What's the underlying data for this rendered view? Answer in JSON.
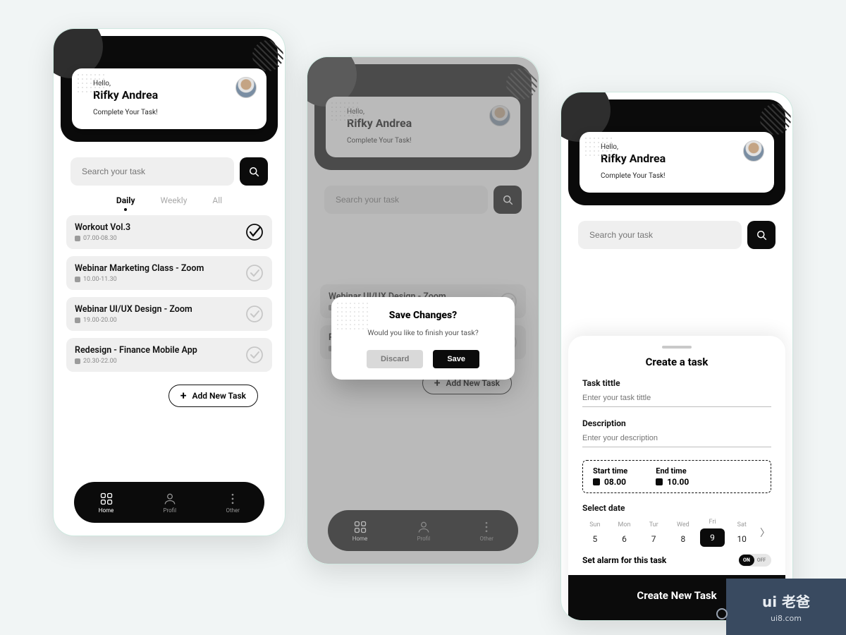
{
  "greeting": {
    "hello": "Hello,",
    "name": "Rifky Andrea",
    "subtitle": "Complete Your Task!"
  },
  "search": {
    "placeholder": "Search your task"
  },
  "tabs": {
    "daily": "Daily",
    "weekly": "Weekly",
    "all": "All"
  },
  "tasks": [
    {
      "title": "Workout Vol.3",
      "time": "07.00-08.30",
      "done": true
    },
    {
      "title": "Webinar Marketing Class - Zoom",
      "time": "10.00-11.30",
      "done": false
    },
    {
      "title": "Webinar UI/UX Design - Zoom",
      "time": "19.00-20.00",
      "done": false
    },
    {
      "title": "Redesign - Finance Mobile App",
      "time": "20.30-22.00",
      "done": false
    }
  ],
  "addTask": "Add New Task",
  "nav": {
    "home": "Home",
    "profil": "Profil",
    "other": "Other"
  },
  "modal": {
    "title": "Save Changes?",
    "message": "Would you like to finish your task?",
    "discard": "Discard",
    "save": "Save"
  },
  "create": {
    "heading": "Create a task",
    "taskTitleLabel": "Task tittle",
    "taskTitlePlaceholder": "Enter your task tittle",
    "descLabel": "Description",
    "descPlaceholder": "Enter your description",
    "startLabel": "Start time",
    "startValue": "08.00",
    "endLabel": "End time",
    "endValue": "10.00",
    "selectDate": "Select date",
    "days": [
      {
        "name": "Sun",
        "num": "5"
      },
      {
        "name": "Mon",
        "num": "6"
      },
      {
        "name": "Tur",
        "num": "7"
      },
      {
        "name": "Wed",
        "num": "8"
      },
      {
        "name": "Fri",
        "num": "9"
      },
      {
        "name": "Sat",
        "num": "10"
      }
    ],
    "selectedIndex": 4,
    "alarmLabel": "Set alarm for this task",
    "toggleOn": "ON",
    "toggleOff": "OFF",
    "submit": "Create New Task"
  },
  "watermark": {
    "brand": "ui 老爸",
    "url": "ui8.com"
  }
}
